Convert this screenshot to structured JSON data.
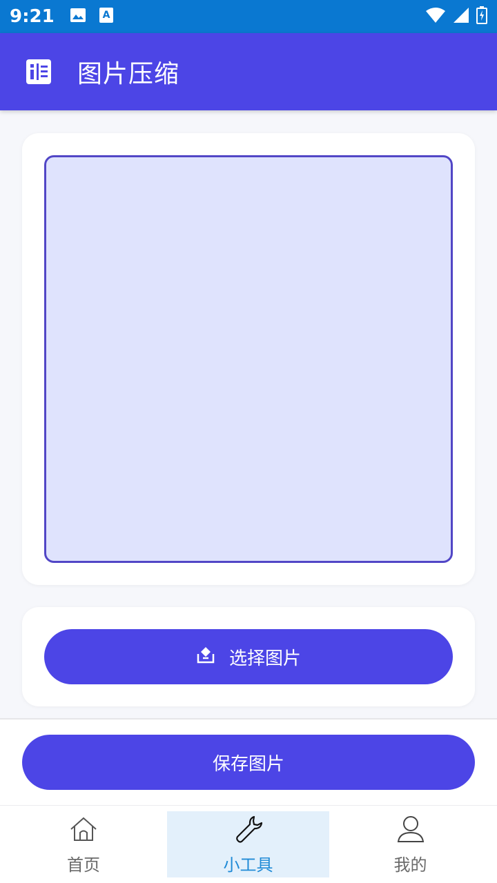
{
  "status_bar": {
    "time": "9:21",
    "icons_left": [
      "image-icon",
      "text-notification-icon"
    ],
    "icons_right": [
      "wifi-icon",
      "signal-icon",
      "battery-charging-icon"
    ]
  },
  "app_bar": {
    "title": "图片压缩",
    "icon": "list-grid-icon"
  },
  "preview": {
    "placeholder_color": "#dfe3fd",
    "border_color": "#5146c6"
  },
  "actions": {
    "select_label": "选择图片",
    "select_icon": "upload-image-icon",
    "save_label": "保存图片"
  },
  "bottom_nav": {
    "items": [
      {
        "label": "首页",
        "icon": "home-icon",
        "active": false
      },
      {
        "label": "小工具",
        "icon": "wrench-icon",
        "active": true
      },
      {
        "label": "我的",
        "icon": "user-icon",
        "active": false
      }
    ]
  },
  "colors": {
    "status_bar": "#0a78d1",
    "primary": "#4c45e6",
    "nav_active_bg": "#e3f0fb",
    "nav_active_text": "#1f8ad6"
  }
}
